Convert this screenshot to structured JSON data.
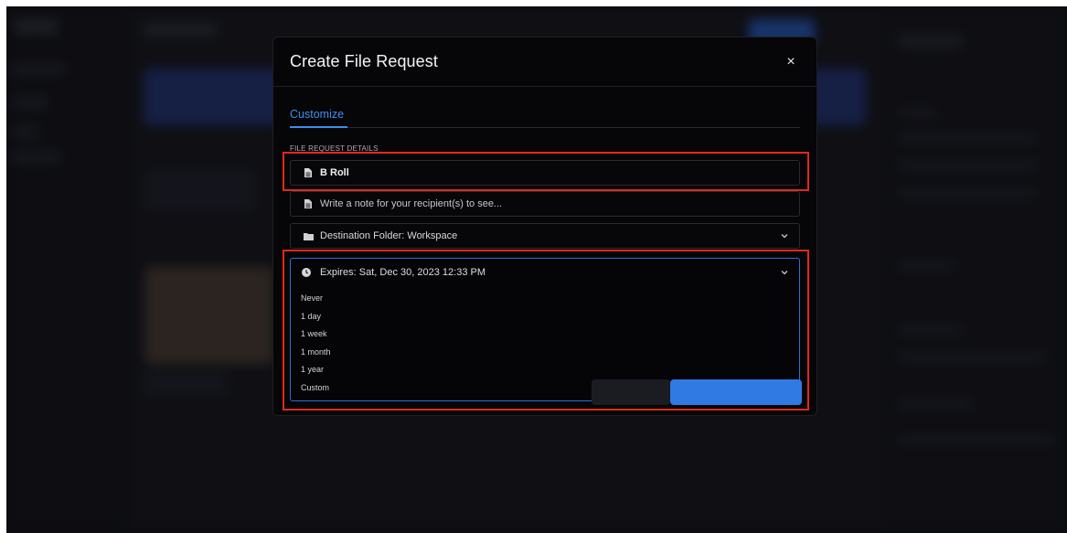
{
  "modal": {
    "title": "Create File Request",
    "close_icon": "×",
    "tabs": [
      {
        "label": "Customize",
        "active": true
      }
    ],
    "section_label": "FILE REQUEST DETAILS",
    "name_field": {
      "value": "B Roll",
      "icon": "file-icon"
    },
    "note_field": {
      "placeholder": "Write a note for your recipient(s) to see...",
      "icon": "file-icon"
    },
    "destination": {
      "label": "Destination Folder: Workspace",
      "icon": "folder-icon"
    },
    "expires": {
      "label": "Expires: Sat, Dec 30, 2023 12:33 PM",
      "icon": "clock-icon",
      "options": [
        "Never",
        "1 day",
        "1 week",
        "1 month",
        "1 year",
        "Custom"
      ]
    }
  },
  "colors": {
    "accent": "#3d8ef0",
    "highlight": "#e0291c",
    "modal_bg": "#060608"
  }
}
